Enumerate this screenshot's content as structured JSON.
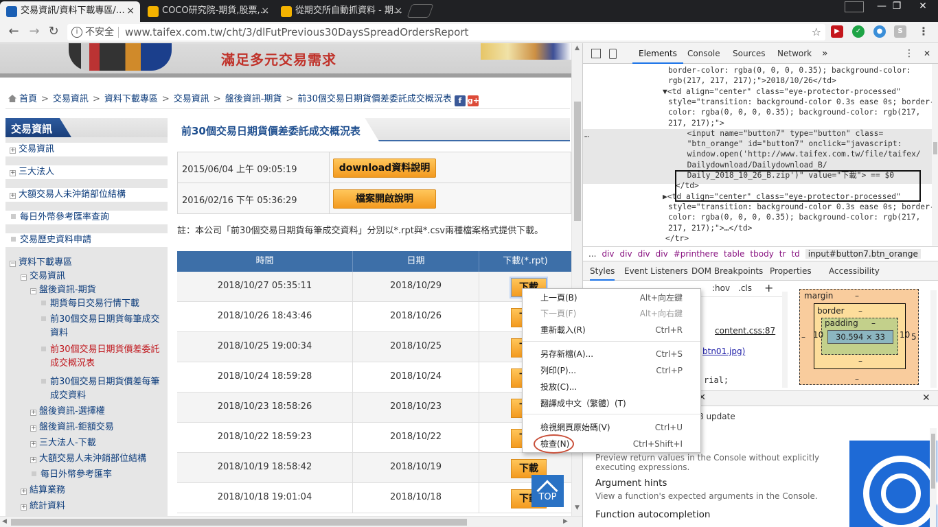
{
  "browser": {
    "tabs": [
      {
        "title": "交易資訊/資料下載專區/…",
        "fav_color": "#1a5fb4"
      },
      {
        "title": "COCO研究院-期貨,股票,…",
        "fav_color": "#f5b300"
      },
      {
        "title": "從期交所自動抓資料 - 期…",
        "fav_color": "#f5b300"
      }
    ],
    "tab_close": "×",
    "insecure_label": "不安全",
    "url": "www.taifex.com.tw/cht/3/dlFutPrevious30DaysSpreadOrdersReport",
    "win_min": "—",
    "win_max": "❐",
    "win_close": "✕"
  },
  "page": {
    "banner_slogan": "滿足多元交易需求",
    "breadcrumb": [
      "首頁",
      "交易資訊",
      "資料下載專區",
      "交易資訊",
      "盤後資訊-期貨",
      "前30個交易日期貨價差委託成交概況表"
    ],
    "social": {
      "facebook": "f",
      "gplus": "g+"
    },
    "sidebar": {
      "title": "交易資訊",
      "level1": [
        {
          "label": "交易資訊",
          "marker": "+"
        },
        {
          "label": "三大法人",
          "marker": "+"
        },
        {
          "label": "大額交易人未沖銷部位結構",
          "marker": "+"
        },
        {
          "label": "每日外幣參考匯率查詢",
          "marker": "dot"
        },
        {
          "label": "交易歷史資料申請",
          "marker": "dot"
        }
      ],
      "tree": [
        {
          "label": "資料下載專區",
          "marker": "−"
        },
        {
          "label": "交易資訊",
          "marker": "−"
        },
        {
          "label": "盤後資訊-期貨",
          "marker": "−"
        },
        {
          "label": "期貨每日交易行情下載",
          "marker": "dot"
        },
        {
          "label": "前30個交易日期貨每筆成交",
          "label2": "資料",
          "marker": "dot"
        },
        {
          "label": "前30個交易日期貨價差委託",
          "label2": "成交概況表",
          "marker": "dot",
          "active": true
        },
        {
          "label": "前30個交易日期貨價差每筆",
          "label2": "成交資料",
          "marker": "dot"
        },
        {
          "label": "盤後資訊-選擇權",
          "marker": "+"
        },
        {
          "label": "盤後資訊-鉅額交易",
          "marker": "+"
        },
        {
          "label": "三大法人-下載",
          "marker": "+"
        },
        {
          "label": "大額交易人未沖銷部位結構",
          "marker": "+"
        },
        {
          "label": "每日外幣參考匯率",
          "marker": "dot"
        },
        {
          "label": "結算業務",
          "marker": "+"
        },
        {
          "label": "統計資料",
          "marker": "+"
        }
      ]
    },
    "content_title": "前30個交易日期貨價差委託成交概況表",
    "doc_rows": [
      {
        "time": "2015/06/04 上午 09:05:19",
        "button": "download資料說明"
      },
      {
        "time": "2016/02/16 下午 05:36:29",
        "button": "檔案開啟說明"
      }
    ],
    "note": "註：本公司「前30個交易日期貨每筆成交資料」分別以*.rpt與*.csv兩種檔案格式提供下載。",
    "table": {
      "headers": [
        "時間",
        "日期",
        "下載(*.rpt)"
      ],
      "rows": [
        {
          "time": "2018/10/27 05:35:11",
          "date": "2018/10/29",
          "btn": "下載"
        },
        {
          "time": "2018/10/26 18:43:46",
          "date": "2018/10/26",
          "btn": "下載"
        },
        {
          "time": "2018/10/25 19:00:34",
          "date": "2018/10/25",
          "btn": "下載"
        },
        {
          "time": "2018/10/24 18:59:28",
          "date": "2018/10/24",
          "btn": "下載"
        },
        {
          "time": "2018/10/23 18:58:26",
          "date": "2018/10/23",
          "btn": "下載"
        },
        {
          "time": "2018/10/22 18:59:23",
          "date": "2018/10/22",
          "btn": "下載"
        },
        {
          "time": "2018/10/19 18:58:42",
          "date": "2018/10/19",
          "btn": "下載"
        },
        {
          "time": "2018/10/18 19:01:04",
          "date": "2018/10/18",
          "btn": "下載"
        }
      ]
    },
    "top_button": "TOP"
  },
  "context_menu": {
    "items": [
      {
        "label": "上一頁(B)",
        "shortcut": "Alt+向左鍵",
        "disabled": false
      },
      {
        "label": "下一頁(F)",
        "shortcut": "Alt+向右鍵",
        "disabled": true
      },
      {
        "label": "重新載入(R)",
        "shortcut": "Ctrl+R",
        "disabled": false
      },
      {
        "label": "另存新檔(A)...",
        "shortcut": "Ctrl+S",
        "disabled": false
      },
      {
        "label": "列印(P)...",
        "shortcut": "Ctrl+P",
        "disabled": false
      },
      {
        "label": "投放(C)...",
        "shortcut": "",
        "disabled": false
      },
      {
        "label": "翻譯成中文（繁體）(T)",
        "shortcut": "",
        "disabled": false
      },
      {
        "label": "檢視網頁原始碼(V)",
        "shortcut": "Ctrl+U",
        "disabled": false
      },
      {
        "label": "檢查(N)",
        "shortcut": "Ctrl+Shift+I",
        "disabled": false
      }
    ]
  },
  "devtools": {
    "tabs": [
      "Elements",
      "Console",
      "Sources",
      "Network"
    ],
    "more": "»",
    "menu": "⋮",
    "close": "✕",
    "dom_lines": [
      "border-color: rgba(0, 0, 0, 0.35); background-color:",
      "rgb(217, 217, 217);\">2018/10/26</td>",
      "▼<td align=\"center\" class=\"eye-protector-processed\"",
      "style=\"transition: background-color 0.3s ease 0s; border-",
      "color: rgba(0, 0, 0, 0.35); background-color: rgb(217,",
      "217, 217);\">",
      "  <input name=\"button7\" type=\"button\" class=",
      "  \"btn_orange\" id=\"button7\" onclick=\"javascript:",
      "  window.open('http://www.taifex.com.tw/file/taifex/",
      "  Dailydownload/Dailydownload_B/",
      "  Daily_2018_10_26_B.zip')\" value=\"下載\"> == $0",
      " </td>",
      "▶<td align=\"center\" class=\"eye-protector-processed\"",
      "style=\"transition: background-color 0.3s ease 0s; border-",
      "color: rgba(0, 0, 0, 0.35); background-color: rgb(217,",
      "217, 217);\">…</td>",
      "</tr>"
    ],
    "ellipsis": "…",
    "crumbs": [
      "...",
      "div",
      "div",
      "div",
      "div",
      "#printhere",
      "table",
      "tbody",
      "tr",
      "td",
      "input#button7.btn_orange"
    ],
    "sub_tabs": [
      "Styles",
      "Event Listeners",
      "DOM Breakpoints",
      "Properties",
      "Accessibility"
    ],
    "styles": {
      "hov": ":hov",
      "cls": ".cls",
      "plus": "+",
      "source": "content.css:87",
      "bg_ref": "btn01.jpg)",
      "font_frag": "rial;"
    },
    "box_model": {
      "margin": "margin",
      "border": "border",
      "padding": "padding",
      "content": "30.594 × 33",
      "dash": "–",
      "pad_left": "10",
      "pad_right": "10",
      "side_right": "5"
    },
    "drawer": {
      "update": "8 update",
      "items": [
        {
          "title": "",
          "desc": "Preview return values in the Console without explicitly executing expressions."
        },
        {
          "title": "Argument hints",
          "desc": "View a function's expected arguments in the Console."
        },
        {
          "title": "Function autocompletion",
          "desc": ""
        }
      ]
    }
  }
}
